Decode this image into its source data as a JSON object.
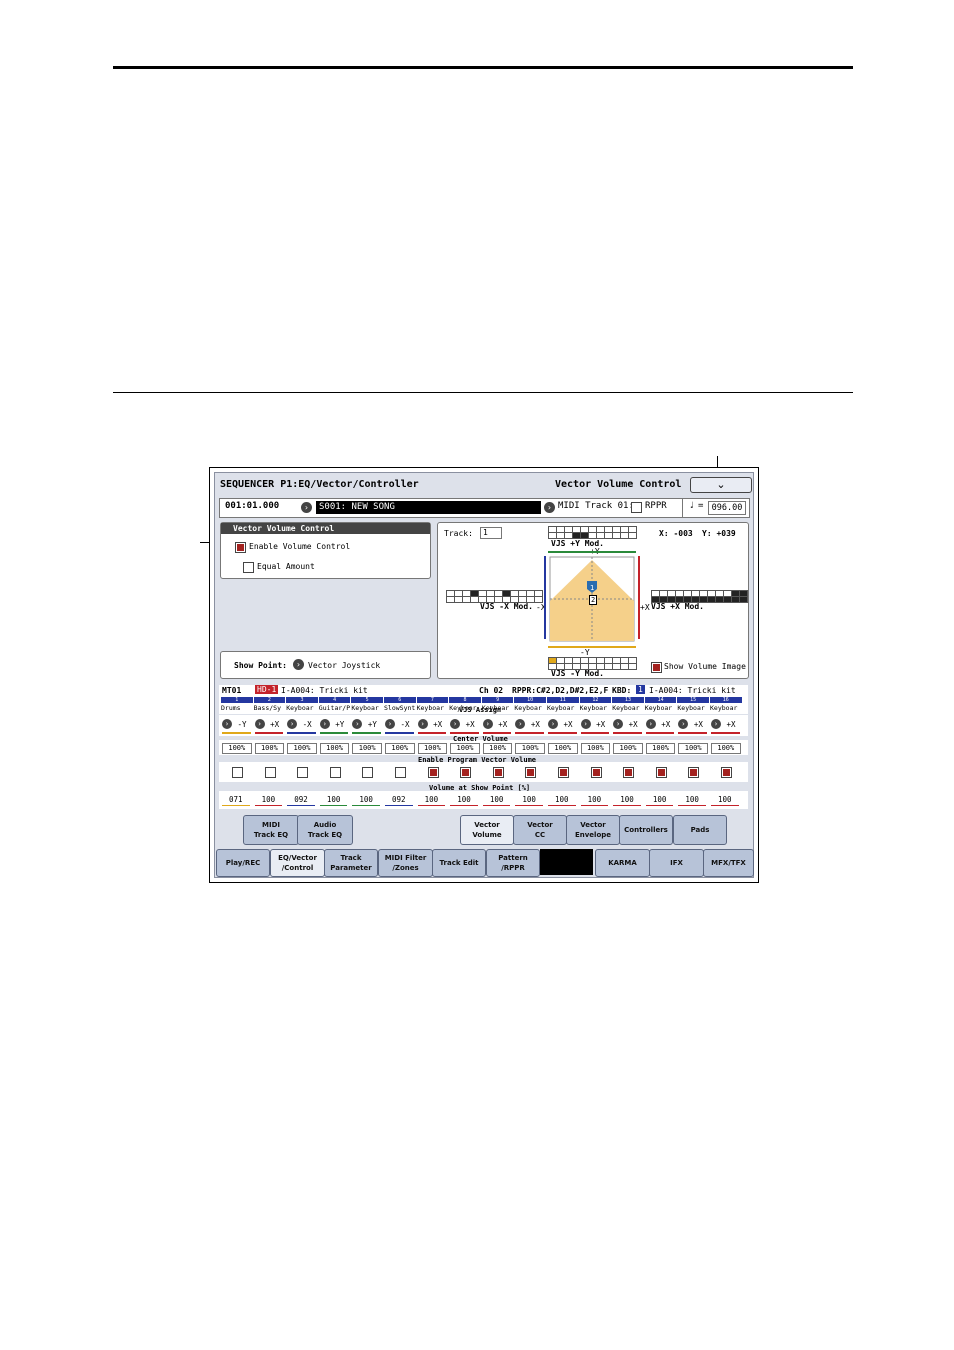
{
  "screen": {
    "title": "SEQUENCER P1:EQ/Vector/Controller",
    "page_name": "Vector Volume Control",
    "location": "001:01.000",
    "song": "S001: NEW SONG",
    "midi_track": "MIDI Track 01:",
    "rppr_label": "RPPR",
    "tempo_symbol": "♩",
    "tempo": "096.00",
    "menu_icon": "chevron-down-icon"
  },
  "vvc_panel": {
    "title": "Vector Volume Control",
    "enable_label": "Enable Volume Control",
    "enable_checked": true,
    "equal_label": "Equal Amount",
    "equal_checked": false,
    "show_point_label": "Show Point:",
    "show_point_value": "Vector Joystick"
  },
  "vector_panel": {
    "track_label": "Track:",
    "track_value": "1",
    "x_readout": "X: -003",
    "y_readout": "Y: +039",
    "plus_y_mod": "VJS +Y Mod.",
    "minus_x_mod": "VJS -X Mod.",
    "plus_x_mod": "VJS +X Mod.",
    "minus_y_mod": "VJS -Y Mod.",
    "plus_y": "+Y",
    "minus_y": "-Y",
    "minus_x": "-X",
    "plus_x": "+X",
    "show_volume_image": "Show Volume Image",
    "show_volume_image_checked": true,
    "point_label": "1",
    "center_label": "2"
  },
  "track_header": {
    "track": "MT01",
    "bank": "HD-1",
    "program": "I-A004: Tricki kit",
    "channel": "Ch 02",
    "rppr": "RPPR:C#2,D2,D#2,E2,F",
    "kbd": "KBD:",
    "kbd_num": "1",
    "kbd_program": "I-A004: Tricki kit"
  },
  "labels": {
    "vjs_assign": "VJS Assign",
    "center_volume": "Center Volume",
    "enable_program": "Enable Program Vector Volume",
    "volume_at_show_point": "Volume at Show Point [%]"
  },
  "tracks": [
    {
      "num": "1",
      "name": "Drums",
      "assign": "-Y",
      "center": "100%",
      "enable": false,
      "vol": "071"
    },
    {
      "num": "2",
      "name": "Bass/Sy",
      "assign": "+X",
      "center": "100%",
      "enable": false,
      "vol": "100"
    },
    {
      "num": "3",
      "name": "Keyboar",
      "assign": "-X",
      "center": "100%",
      "enable": false,
      "vol": "092"
    },
    {
      "num": "4",
      "name": "Guitar/P",
      "assign": "+Y",
      "center": "100%",
      "enable": false,
      "vol": "100"
    },
    {
      "num": "5",
      "name": "Keyboar",
      "assign": "+Y",
      "center": "100%",
      "enable": false,
      "vol": "100"
    },
    {
      "num": "6",
      "name": "SlowSynt",
      "assign": "-X",
      "center": "100%",
      "enable": false,
      "vol": "092"
    },
    {
      "num": "7",
      "name": "Keyboar",
      "assign": "+X",
      "center": "100%",
      "enable": true,
      "vol": "100"
    },
    {
      "num": "8",
      "name": "Keyboar",
      "assign": "+X",
      "center": "100%",
      "enable": true,
      "vol": "100"
    },
    {
      "num": "9",
      "name": "Keyboar",
      "assign": "+X",
      "center": "100%",
      "enable": true,
      "vol": "100"
    },
    {
      "num": "10",
      "name": "Keyboar",
      "assign": "+X",
      "center": "100%",
      "enable": true,
      "vol": "100"
    },
    {
      "num": "11",
      "name": "Keyboar",
      "assign": "+X",
      "center": "100%",
      "enable": true,
      "vol": "100"
    },
    {
      "num": "12",
      "name": "Keyboar",
      "assign": "+X",
      "center": "100%",
      "enable": true,
      "vol": "100"
    },
    {
      "num": "13",
      "name": "Keyboar",
      "assign": "+X",
      "center": "100%",
      "enable": true,
      "vol": "100"
    },
    {
      "num": "14",
      "name": "Keyboar",
      "assign": "+X",
      "center": "100%",
      "enable": true,
      "vol": "100"
    },
    {
      "num": "15",
      "name": "Keyboar",
      "assign": "+X",
      "center": "100%",
      "enable": true,
      "vol": "100"
    },
    {
      "num": "16",
      "name": "Keyboar",
      "assign": "+X",
      "center": "100%",
      "enable": true,
      "vol": "100"
    }
  ],
  "assign_colors": {
    "-Y": "#e0a81a",
    "+X": "#c4222a",
    "-X": "#2437a0",
    "+Y": "#2a8a3a"
  },
  "subtabs": [
    {
      "l1": "MIDI",
      "l2": "Track EQ"
    },
    {
      "l1": "Audio",
      "l2": "Track EQ"
    },
    {
      "l1": "Vector",
      "l2": "Volume"
    },
    {
      "l1": "Vector",
      "l2": "CC"
    },
    {
      "l1": "Vector",
      "l2": "Envelope"
    },
    {
      "l1": "Controllers",
      "l2": ""
    },
    {
      "l1": "Pads",
      "l2": ""
    }
  ],
  "maintabs": [
    {
      "l1": "Play/REC",
      "l2": ""
    },
    {
      "l1": "EQ/Vector",
      "l2": "/Control"
    },
    {
      "l1": "Track",
      "l2": "Parameter"
    },
    {
      "l1": "MIDI Filter",
      "l2": "/Zones"
    },
    {
      "l1": "Track Edit",
      "l2": ""
    },
    {
      "l1": "Pattern",
      "l2": "/RPPR"
    },
    {
      "l1": "KARMA",
      "l2": ""
    },
    {
      "l1": "IFX",
      "l2": ""
    },
    {
      "l1": "MFX/TFX",
      "l2": ""
    }
  ]
}
